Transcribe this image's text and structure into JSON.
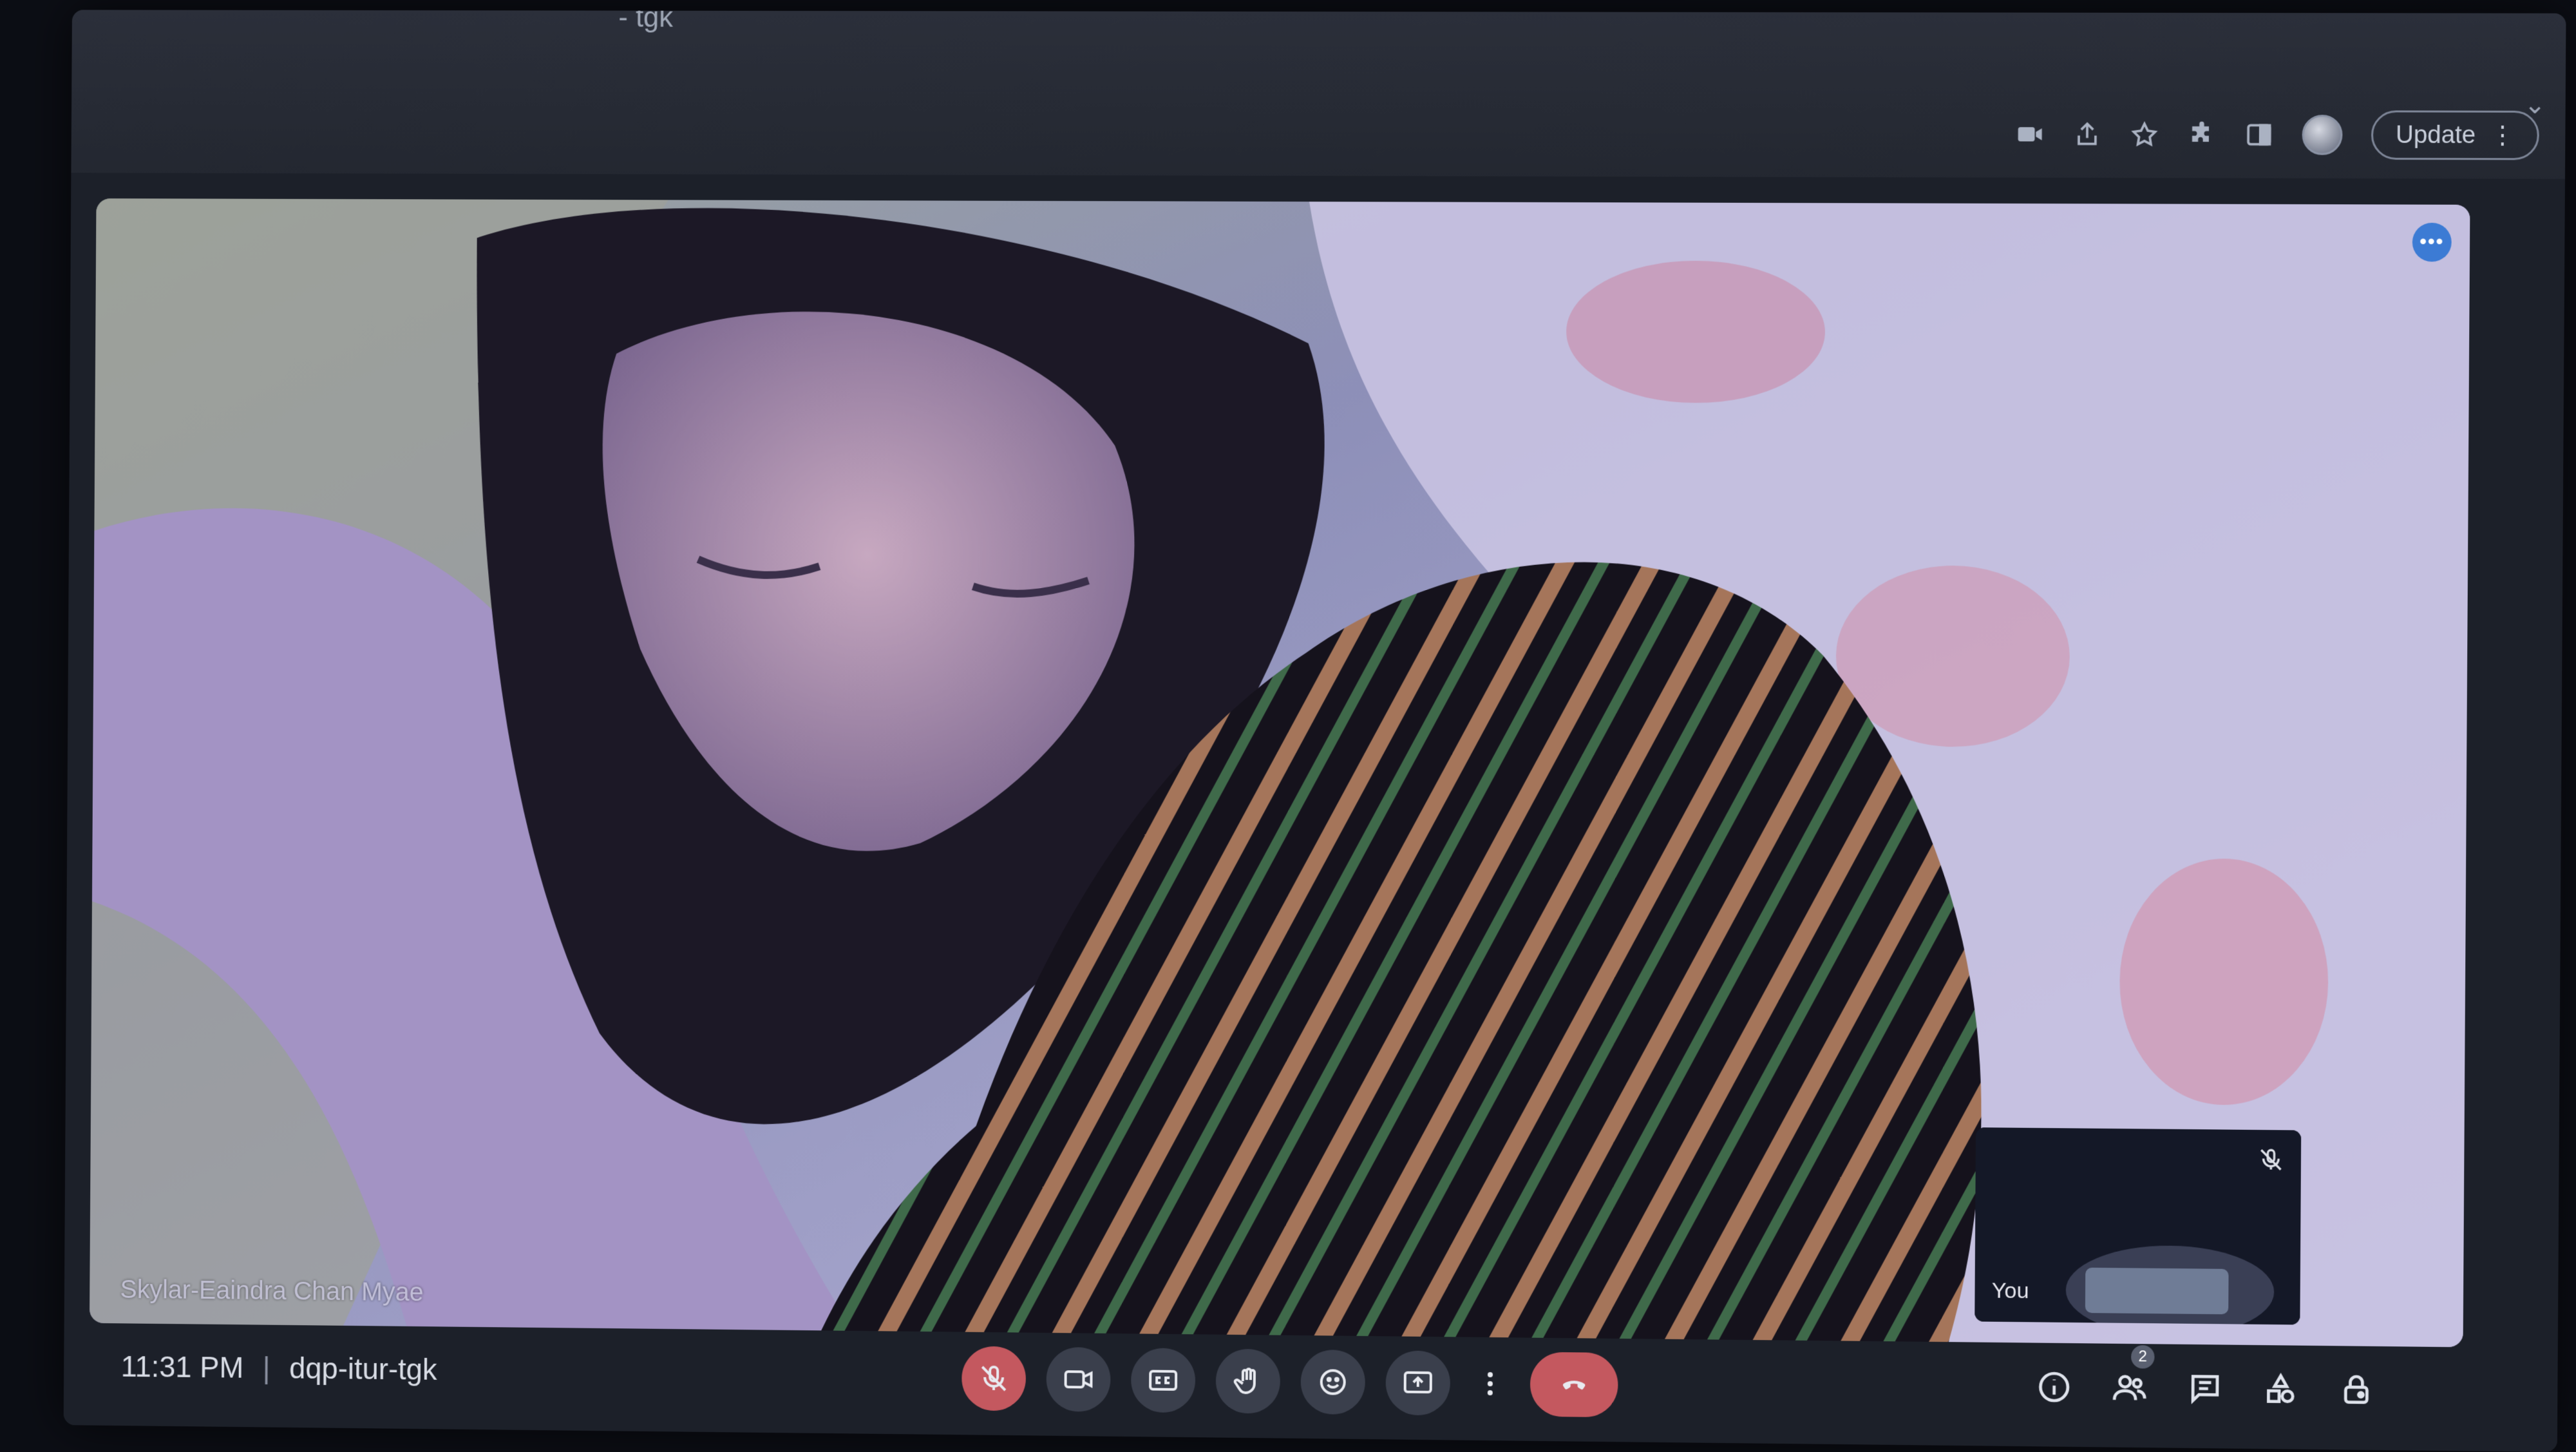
{
  "browser": {
    "tab_title": "- tgk",
    "update_label": "Update"
  },
  "meeting": {
    "time": "11:31 PM",
    "separator": "|",
    "code": "dqp-itur-tgk",
    "participant_count": "2"
  },
  "main_tile": {
    "speaker_name": "Skylar-Eaindra Chan Myae",
    "more_icon": "more-horizontal-icon"
  },
  "self_view": {
    "label": "You",
    "muted": true
  },
  "controls": {
    "center": [
      "mic-off-icon",
      "camera-icon",
      "captions-icon",
      "raise-hand-icon",
      "emoji-icon",
      "present-icon",
      "more-vert-icon",
      "hangup-icon"
    ],
    "right": [
      "info-icon",
      "people-icon",
      "chat-icon",
      "activities-icon",
      "host-controls-icon"
    ]
  },
  "colors": {
    "accent_red": "#c4585f",
    "dots_blue": "#3c7bd4",
    "control_bg": "#3a3f4c"
  }
}
